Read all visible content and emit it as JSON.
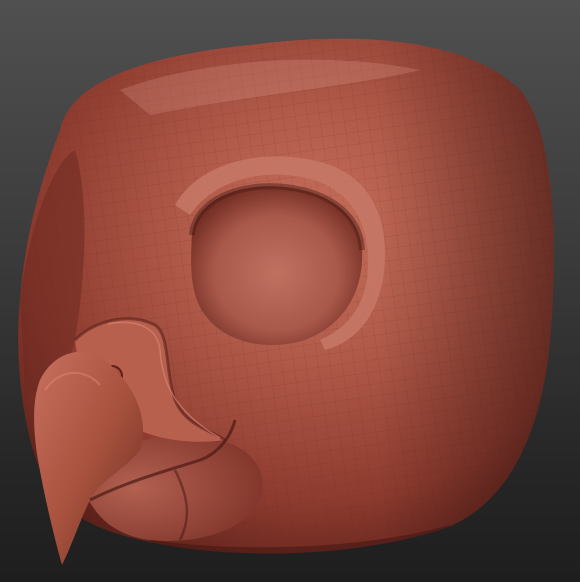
{
  "scene": {
    "subject": "bird-head-sculpt",
    "material_color": "#a84a3c",
    "highlight_color": "#d98a78",
    "shadow_color": "#4a1a14",
    "background_top": "#505050",
    "background_bottom": "#1e1e1e",
    "wireframe_visible": true
  }
}
